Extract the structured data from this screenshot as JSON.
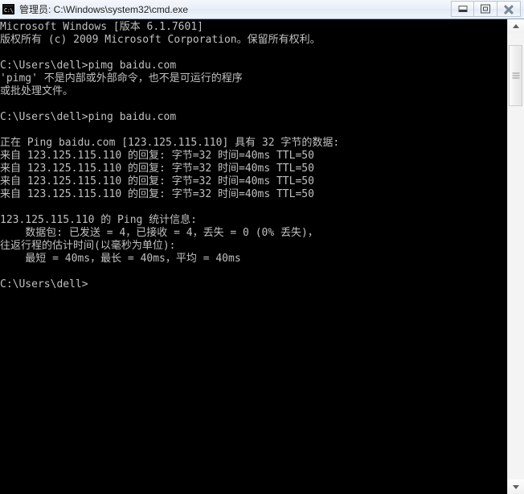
{
  "window": {
    "title": "管理员: C:\\Windows\\system32\\cmd.exe",
    "icon_text": "C:\\",
    "controls": {
      "minimize_label": "最小化",
      "maximize_label": "最大化",
      "close_label": "关闭"
    }
  },
  "console": {
    "background_color": "#000000",
    "foreground_color": "#c0c0c0",
    "lines": [
      "Microsoft Windows [版本 6.1.7601]",
      "版权所有 (c) 2009 Microsoft Corporation。保留所有权利。",
      "",
      "C:\\Users\\dell>pimg baidu.com",
      "'pimg' 不是内部或外部命令，也不是可运行的程序",
      "或批处理文件。",
      "",
      "C:\\Users\\dell>ping baidu.com",
      "",
      "正在 Ping baidu.com [123.125.115.110] 具有 32 字节的数据:",
      "来自 123.125.115.110 的回复: 字节=32 时间=40ms TTL=50",
      "来自 123.125.115.110 的回复: 字节=32 时间=40ms TTL=50",
      "来自 123.125.115.110 的回复: 字节=32 时间=40ms TTL=50",
      "来自 123.125.115.110 的回复: 字节=32 时间=40ms TTL=50",
      "",
      "123.125.115.110 的 Ping 统计信息:",
      "    数据包: 已发送 = 4，已接收 = 4，丢失 = 0 (0% 丢失)，",
      "往返行程的估计时间(以毫秒为单位):",
      "    最短 = 40ms，最长 = 40ms，平均 = 40ms",
      "",
      "C:\\Users\\dell>"
    ],
    "commands": [
      {
        "prompt": "C:\\Users\\dell>",
        "command": "pimg baidu.com",
        "result": "error"
      },
      {
        "prompt": "C:\\Users\\dell>",
        "command": "ping baidu.com",
        "result": "success"
      }
    ],
    "ping_result": {
      "host": "baidu.com",
      "ip": "123.125.115.110",
      "payload_bytes": 32,
      "replies": [
        {
          "bytes": 32,
          "time_ms": 40,
          "ttl": 50
        },
        {
          "bytes": 32,
          "time_ms": 40,
          "ttl": 50
        },
        {
          "bytes": 32,
          "time_ms": 40,
          "ttl": 50
        },
        {
          "bytes": 32,
          "time_ms": 40,
          "ttl": 50
        }
      ],
      "statistics": {
        "sent": 4,
        "received": 4,
        "lost": 0,
        "loss_percent": 0,
        "min_ms": 40,
        "max_ms": 40,
        "avg_ms": 40
      }
    }
  },
  "scrollbar": {
    "up_arrow": "scroll-up-arrow",
    "down_arrow": "scroll-down-arrow",
    "thumb_position_percent": 3
  }
}
